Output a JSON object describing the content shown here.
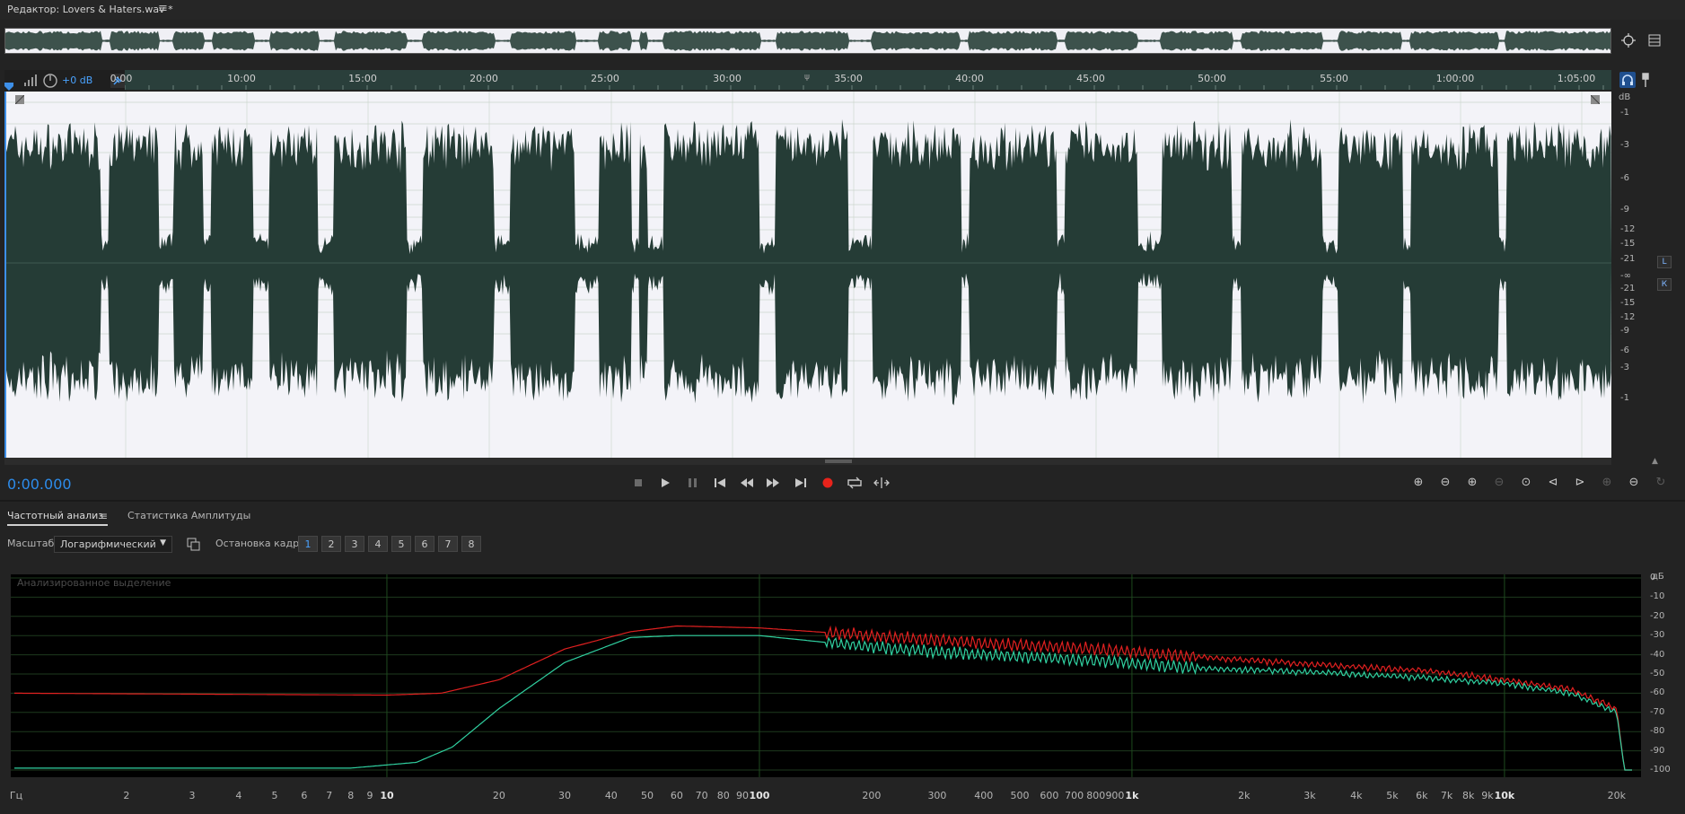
{
  "window": {
    "title": "Редактор: Lovers & Haters.wav *",
    "menu_icon": "hamburger-icon"
  },
  "overview": {
    "right_icons": [
      "zoom-to-fit-icon",
      "panel-toggle-icon"
    ]
  },
  "timeline": {
    "labels": [
      "0:00",
      "10:00",
      "15:00",
      "20:00",
      "25:00",
      "30:00",
      "35:00",
      "40:00",
      "45:00",
      "50:00",
      "55:00",
      "1:00:00",
      "1:05:00"
    ],
    "marker_glyph": "ψ",
    "gain_label": "+0 dB"
  },
  "amp_scale": {
    "unit": "dB",
    "top": [
      "-1",
      "-3",
      "-6",
      "-9",
      "-12",
      "-15",
      "-21"
    ],
    "mid": "-∞",
    "bottom": [
      "-21",
      "-15",
      "-12",
      "-9",
      "-6",
      "-3",
      "-1"
    ]
  },
  "channels": {
    "left": "L",
    "right": "К"
  },
  "transport": {
    "time": "0:00.000",
    "buttons": [
      "stop",
      "play",
      "pause",
      "move-to-start",
      "rewind",
      "fast-forward",
      "move-to-end",
      "record",
      "loop",
      "skip-selection"
    ]
  },
  "zoom_tools": [
    "zoom-in-amplitude",
    "zoom-out-amplitude",
    "zoom-in-time",
    "zoom-out-time",
    "zoom-fit",
    "zoom-in-left",
    "zoom-in-right",
    "zoom-in-selection",
    "zoom-out-selection",
    "zoom-reset"
  ],
  "analysis": {
    "tabs": [
      "Частотный анализ",
      "Статистика Амплитуды"
    ],
    "scale_label": "Масштаб:",
    "scale_value": "Логарифмический",
    "freeze_label": "Остановка кадра:",
    "frames": [
      "1",
      "2",
      "3",
      "4",
      "5",
      "6",
      "7",
      "8"
    ],
    "frame_colors": [
      "#e02020",
      "#f08000",
      "#e8e800",
      "#a0e000",
      "#30c030",
      "#20d0d0",
      "#3090f0",
      "#e020e0"
    ],
    "caption": "Анализированное выделение"
  },
  "chart_data": [
    {
      "type": "line",
      "title": "",
      "xlabel": "Гц",
      "ylabel": "дБ",
      "x_scale": "log",
      "xlim": [
        1,
        22000
      ],
      "ylim": [
        -100,
        0
      ],
      "x_ticks": [
        "2",
        "3",
        "4",
        "5",
        "6",
        "7",
        "8",
        "9",
        "10",
        "20",
        "30",
        "40",
        "50",
        "60",
        "70",
        "80",
        "90",
        "100",
        "200",
        "300",
        "400",
        "500",
        "600",
        "700",
        "800",
        "900",
        "1k",
        "2k",
        "3k",
        "4k",
        "5k",
        "6k",
        "7k",
        "8k",
        "9k",
        "10k",
        "20k"
      ],
      "y_ticks": [
        "0",
        "-10",
        "-20",
        "-30",
        "-40",
        "-50",
        "-60",
        "-70",
        "-80",
        "-90",
        "-100"
      ],
      "grid": true,
      "series": [
        {
          "color": "#e02020",
          "x": [
            1,
            10,
            14,
            20,
            30,
            45,
            60,
            100,
            200,
            400,
            800,
            1500,
            3000,
            6000,
            10000,
            15000,
            20000,
            21000
          ],
          "values": [
            -60,
            -61,
            -60,
            -53,
            -37,
            -28,
            -25,
            -26,
            -30,
            -34,
            -37,
            -41,
            -45,
            -48,
            -53,
            -58,
            -68,
            -100
          ]
        },
        {
          "color": "#30d0a0",
          "x": [
            1,
            8,
            12,
            15,
            20,
            30,
            45,
            60,
            100,
            200,
            400,
            800,
            1500,
            3000,
            6000,
            10000,
            15000,
            20000,
            21000
          ],
          "values": [
            -99,
            -99,
            -96,
            -88,
            -68,
            -44,
            -31,
            -30,
            -30,
            -36,
            -40,
            -43,
            -47,
            -49,
            -52,
            -55,
            -60,
            -70,
            -100
          ]
        }
      ]
    }
  ]
}
